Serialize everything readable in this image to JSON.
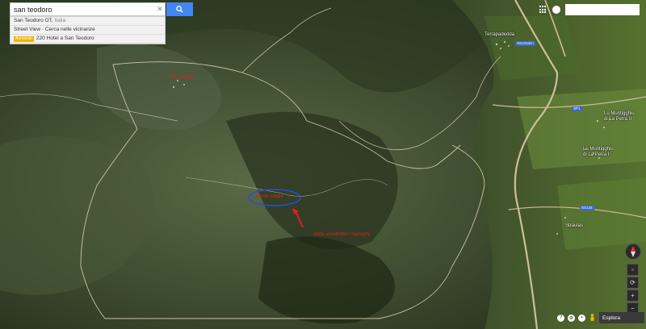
{
  "search": {
    "query": "san teodoro"
  },
  "suggestions": [
    {
      "main": "San Teodoro OT,",
      "secondary": " Italia",
      "ad": ""
    },
    {
      "main": "Street View · Cerca nelle vicinanze",
      "secondary": "",
      "ad": ""
    },
    {
      "main": "220 Hotel a San Teodoro",
      "secondary": "",
      "ad": "Annuncio"
    }
  ],
  "map_labels": {
    "terrapadedda": "Terrapadedda",
    "lu_muntigghiu_1": "Lu Muntigghiu",
    "lu_muntigghiu_1b": "di La Petra II",
    "lu_muntigghiu_2": "Lu Muntigghiu",
    "lu_muntigghiu_2b": "di La Petra I",
    "straulas": "Straulas",
    "ss131dcn": "SS131dcn",
    "sp1": "SP1",
    "ss125": "SS125"
  },
  "annotations": {
    "top": "Ossoseddu",
    "circled": "Punta Istada",
    "arrow": "stelle viewfinder/ marvigny"
  },
  "bottom": {
    "explore_label": "Esplora"
  },
  "colors": {
    "annotation": "#e02020",
    "circle": "#2a4fd8",
    "search_button": "#4285f4"
  }
}
